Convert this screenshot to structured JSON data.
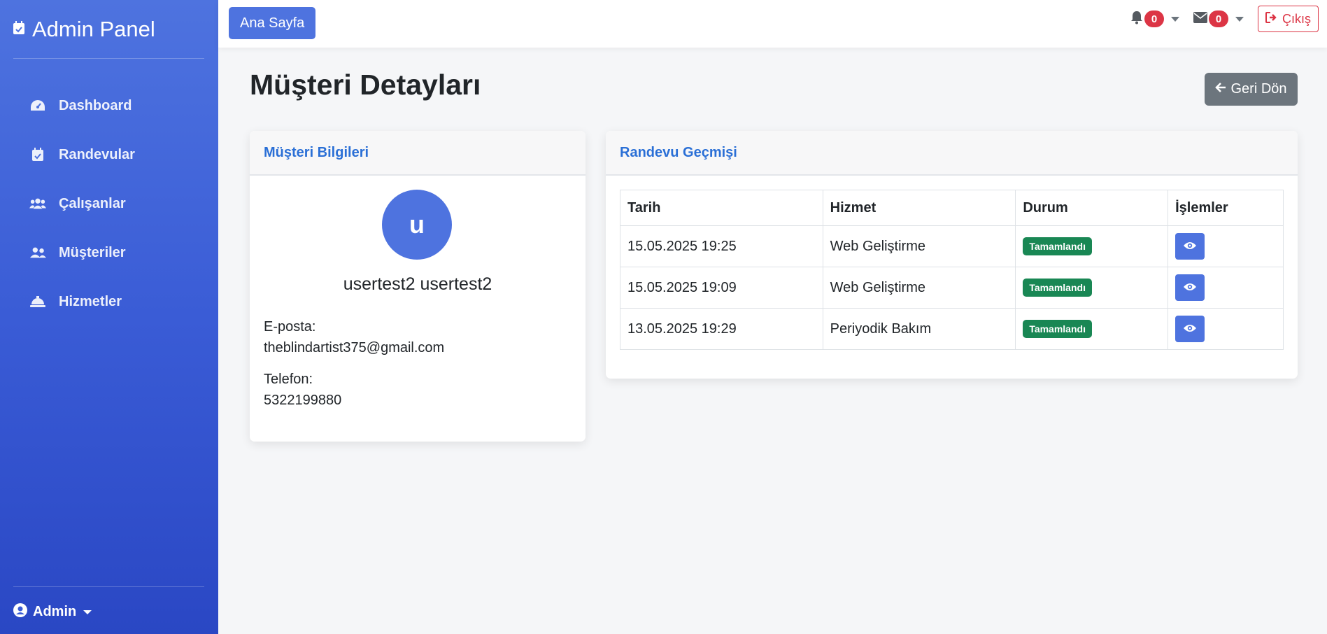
{
  "sidebar": {
    "brand": "Admin Panel",
    "items": [
      {
        "label": "Dashboard",
        "icon": "dashboard-gauge-icon"
      },
      {
        "label": "Randevular",
        "icon": "calendar-check-icon"
      },
      {
        "label": "Çalışanlar",
        "icon": "users-icon"
      },
      {
        "label": "Müşteriler",
        "icon": "user-friends-icon"
      },
      {
        "label": "Hizmetler",
        "icon": "concierge-bell-icon"
      }
    ],
    "user": "Admin"
  },
  "topbar": {
    "home_label": "Ana Sayfa",
    "notifications_count": "0",
    "messages_count": "0",
    "logout_label": "Çıkış"
  },
  "page": {
    "title": "Müşteri Detayları",
    "back_label": "Geri Dön"
  },
  "customer_card": {
    "header": "Müşteri Bilgileri",
    "avatar_letter": "u",
    "name": "usertest2 usertest2",
    "email_label": "E-posta:",
    "email": "theblindartist375@gmail.com",
    "phone_label": "Telefon:",
    "phone": "5322199880"
  },
  "history_card": {
    "header": "Randevu Geçmişi",
    "columns": [
      "Tarih",
      "Hizmet",
      "Durum",
      "İşlemler"
    ],
    "rows": [
      {
        "date": "15.05.2025 19:25",
        "service": "Web Geliştirme",
        "status": "Tamamlandı"
      },
      {
        "date": "15.05.2025 19:09",
        "service": "Web Geliştirme",
        "status": "Tamamlandı"
      },
      {
        "date": "13.05.2025 19:29",
        "service": "Periyodik Bakım",
        "status": "Tamamlandı"
      }
    ]
  },
  "colors": {
    "primary": "#4e73df",
    "danger": "#dc3545",
    "success": "#198754",
    "secondary": "#6c757d",
    "link": "#2a6fd6"
  }
}
